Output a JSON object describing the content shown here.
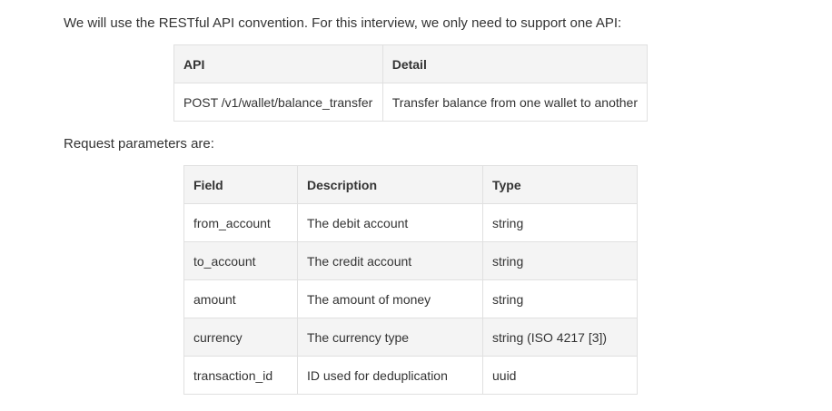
{
  "intro_text": "We will use the RESTful API convention. For this interview, we only need to support one API:",
  "api_table": {
    "headers": [
      "API",
      "Detail"
    ],
    "rows": [
      [
        "POST /v1/wallet/balance_transfer",
        "Transfer balance from one wallet to another"
      ]
    ]
  },
  "request_text": "Request parameters are:",
  "params_table": {
    "headers": [
      "Field",
      "Description",
      "Type"
    ],
    "rows": [
      [
        "from_account",
        "The debit account",
        "string"
      ],
      [
        "to_account",
        "The credit account",
        "string"
      ],
      [
        "amount",
        "The amount of money",
        "string"
      ],
      [
        "currency",
        "The currency type",
        "string (ISO 4217 [3])"
      ],
      [
        "transaction_id",
        "ID used for deduplication",
        "uuid"
      ]
    ]
  }
}
